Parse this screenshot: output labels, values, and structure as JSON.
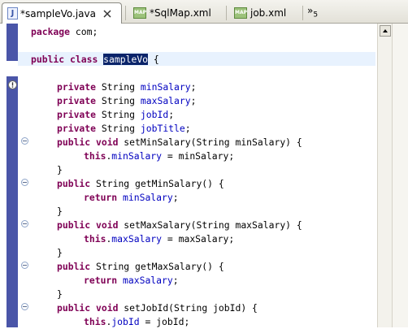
{
  "tabs": [
    {
      "label": "*sampleVo.java",
      "icon": "java-file-icon",
      "active": true
    },
    {
      "label": "*SqlMap.xml",
      "icon": "sqlmap-xml-icon"
    },
    {
      "label": "job.xml",
      "icon": "sqlmap-xml-icon"
    }
  ],
  "tab_overflow": {
    "glyph": "»",
    "count": "5"
  },
  "code": {
    "l1": [
      "package",
      " com;"
    ],
    "l2": [
      "public",
      " ",
      "class",
      " ",
      "sampleVo",
      " {"
    ],
    "decl": [
      [
        "private",
        " String ",
        "minSalary",
        ";"
      ],
      [
        "private",
        " String ",
        "maxSalary",
        ";"
      ],
      [
        "private",
        " String ",
        "jobId",
        ";"
      ],
      [
        "private",
        " String ",
        "jobTitle",
        ";"
      ]
    ],
    "m1": [
      "public",
      " ",
      "void",
      " setMinSalary(String minSalary) {"
    ],
    "m1b": [
      "this",
      ".",
      "minSalary",
      " = minSalary;"
    ],
    "close": "}",
    "m2": [
      "public",
      " String getMinSalary() {"
    ],
    "m2b": [
      "return",
      " ",
      "minSalary",
      ";"
    ],
    "m3": [
      "public",
      " ",
      "void",
      " setMaxSalary(String maxSalary) {"
    ],
    "m3b": [
      "this",
      ".",
      "maxSalary",
      " = maxSalary;"
    ],
    "m4": [
      "public",
      " String getMaxSalary() {"
    ],
    "m4b": [
      "return",
      " ",
      "maxSalary",
      ";"
    ],
    "m5": [
      "public",
      " ",
      "void",
      " setJobId(String jobId) {"
    ],
    "m5b": [
      "this",
      ".",
      "jobId",
      " = jobId;"
    ]
  },
  "colors": {
    "keyword": "#7f0055",
    "field": "#0000c0",
    "selection": "#0a246a",
    "ruler": "#4a55a8"
  }
}
